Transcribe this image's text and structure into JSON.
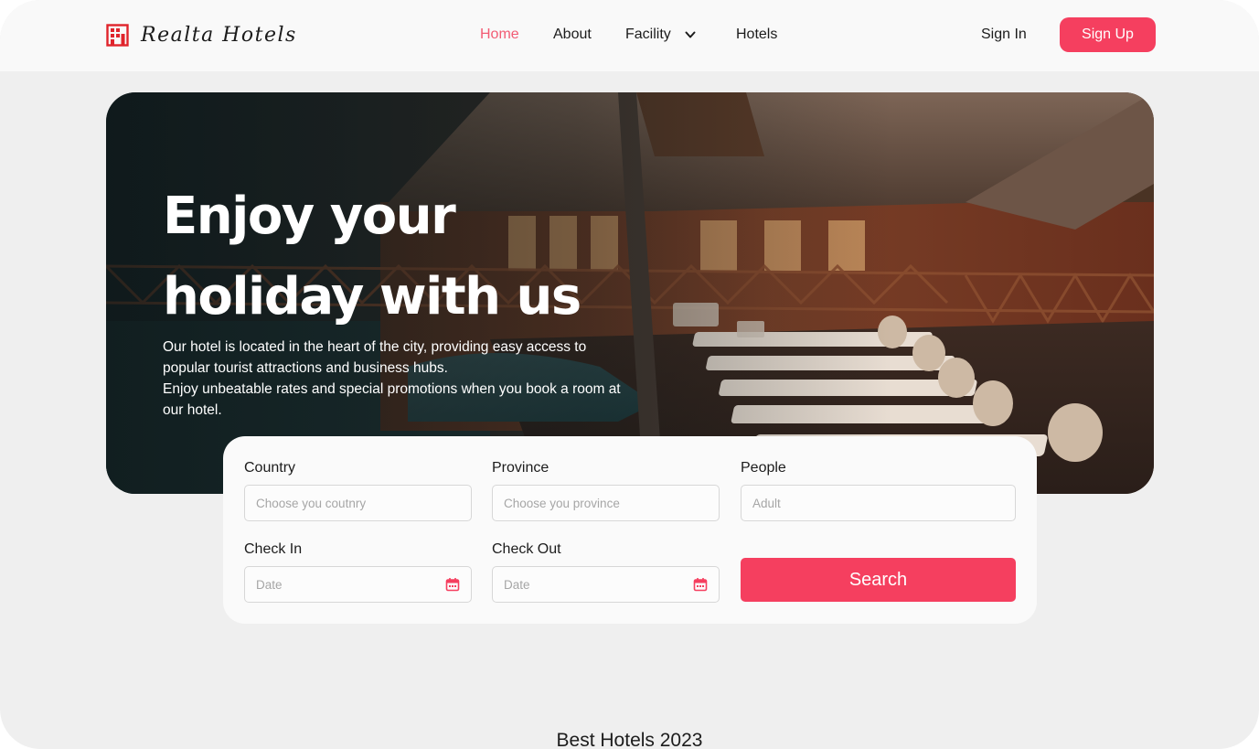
{
  "brand": {
    "name": "Realta Hotels",
    "icon": "hotel-building-icon",
    "accent": "#f53f5f"
  },
  "nav": {
    "items": [
      {
        "label": "Home",
        "active": true
      },
      {
        "label": "About"
      },
      {
        "label": "Facility",
        "icon": "chevron-down-icon"
      },
      {
        "label": "Hotels"
      }
    ]
  },
  "auth": {
    "sign_in": "Sign In",
    "sign_up": "Sign Up"
  },
  "hero": {
    "title_line1": "Enjoy your",
    "title_line2": "holiday with us",
    "description": [
      "Our hotel is located in the heart of the city, providing easy access to",
      "popular tourist attractions and business hubs.",
      "Enjoy unbeatable rates and special promotions when you book a room at",
      "our hotel."
    ]
  },
  "search": {
    "country": {
      "label": "Country",
      "placeholder": "Choose you coutnry"
    },
    "province": {
      "label": "Province",
      "placeholder": "Choose you province"
    },
    "people": {
      "label": "People",
      "placeholder": "Adult"
    },
    "check_in": {
      "label": "Check In",
      "placeholder": "Date",
      "icon": "calendar-icon"
    },
    "check_out": {
      "label": "Check Out",
      "placeholder": "Date",
      "icon": "calendar-icon"
    },
    "button": "Search"
  },
  "sections": {
    "best_hotels_title": "Best Hotels 2023"
  }
}
